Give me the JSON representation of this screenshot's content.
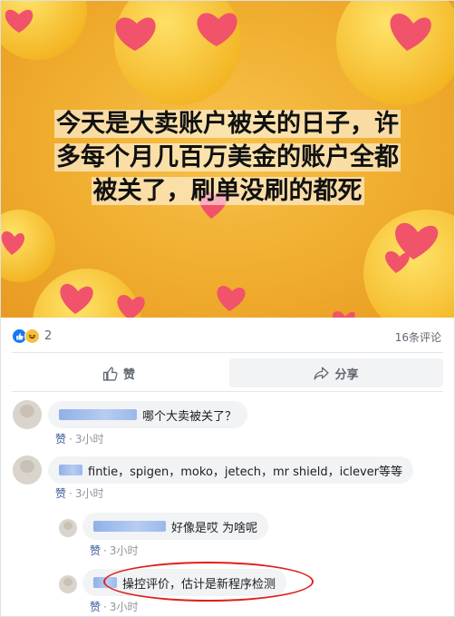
{
  "image": {
    "caption_lines": [
      "今天是大卖账户被关的日子，许",
      "多每个月几百万美金的账户全都",
      "被关了，刷单没刷的都死"
    ],
    "background_color": "#f0ad2e"
  },
  "reactions": {
    "icons": [
      "like-icon",
      "haha-icon"
    ],
    "count": "2",
    "comment_count": "16条评论"
  },
  "actions": {
    "like_label": "赞",
    "share_label": "分享"
  },
  "comments": [
    {
      "text": "哪个大卖被关了？",
      "like_label": "赞",
      "dot": "·",
      "time": "3小时"
    },
    {
      "text": "fintie，spigen，moko，jetech，mr shield，iclever等等",
      "like_label": "赞",
      "dot": "·",
      "time": "3小时"
    }
  ],
  "replies": [
    {
      "text": "好像是哎 为啥呢",
      "like_label": "赞",
      "dot": "·",
      "time": "3小时"
    },
    {
      "text": "操控评价，估计是新程序检测",
      "like_label": "赞",
      "dot": "·",
      "time": "3小时"
    }
  ],
  "colors": {
    "accent": "#1877f2",
    "link": "#385898",
    "highlight_circle": "#e0201c"
  }
}
